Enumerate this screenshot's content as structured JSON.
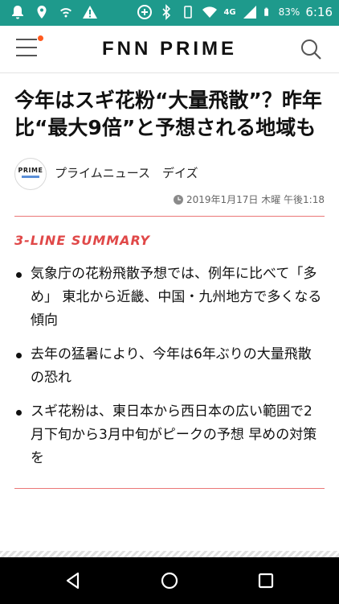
{
  "status_bar": {
    "battery": "83%",
    "time": "6:16",
    "network": "4G"
  },
  "header": {
    "logo": "FNN PRIME"
  },
  "article": {
    "headline": "今年はスギ花粉“大量飛散”？昨年比“最大9倍”と予想される地域も",
    "source_logo_text": "PRIME",
    "source_name": "プライムニュース　デイズ",
    "date": "2019年1月17日 木曜 午後1:18",
    "summary_title": "3-LINE SUMMARY",
    "summary_items": [
      "気象庁の花粉飛散予想では、例年に比べて「多め」 東北から近畿、中国・九州地方で多くなる傾向",
      "去年の猛暑により、今年は6年ぶりの大量飛散の恐れ",
      "スギ花粉は、東日本から西日本の広い範囲で2月下旬から3月中旬がピークの予想 早めの対策を"
    ]
  },
  "colors": {
    "status_bar": "#1e9a8c",
    "accent": "#e04848",
    "notification_dot": "#ff5a1f"
  }
}
